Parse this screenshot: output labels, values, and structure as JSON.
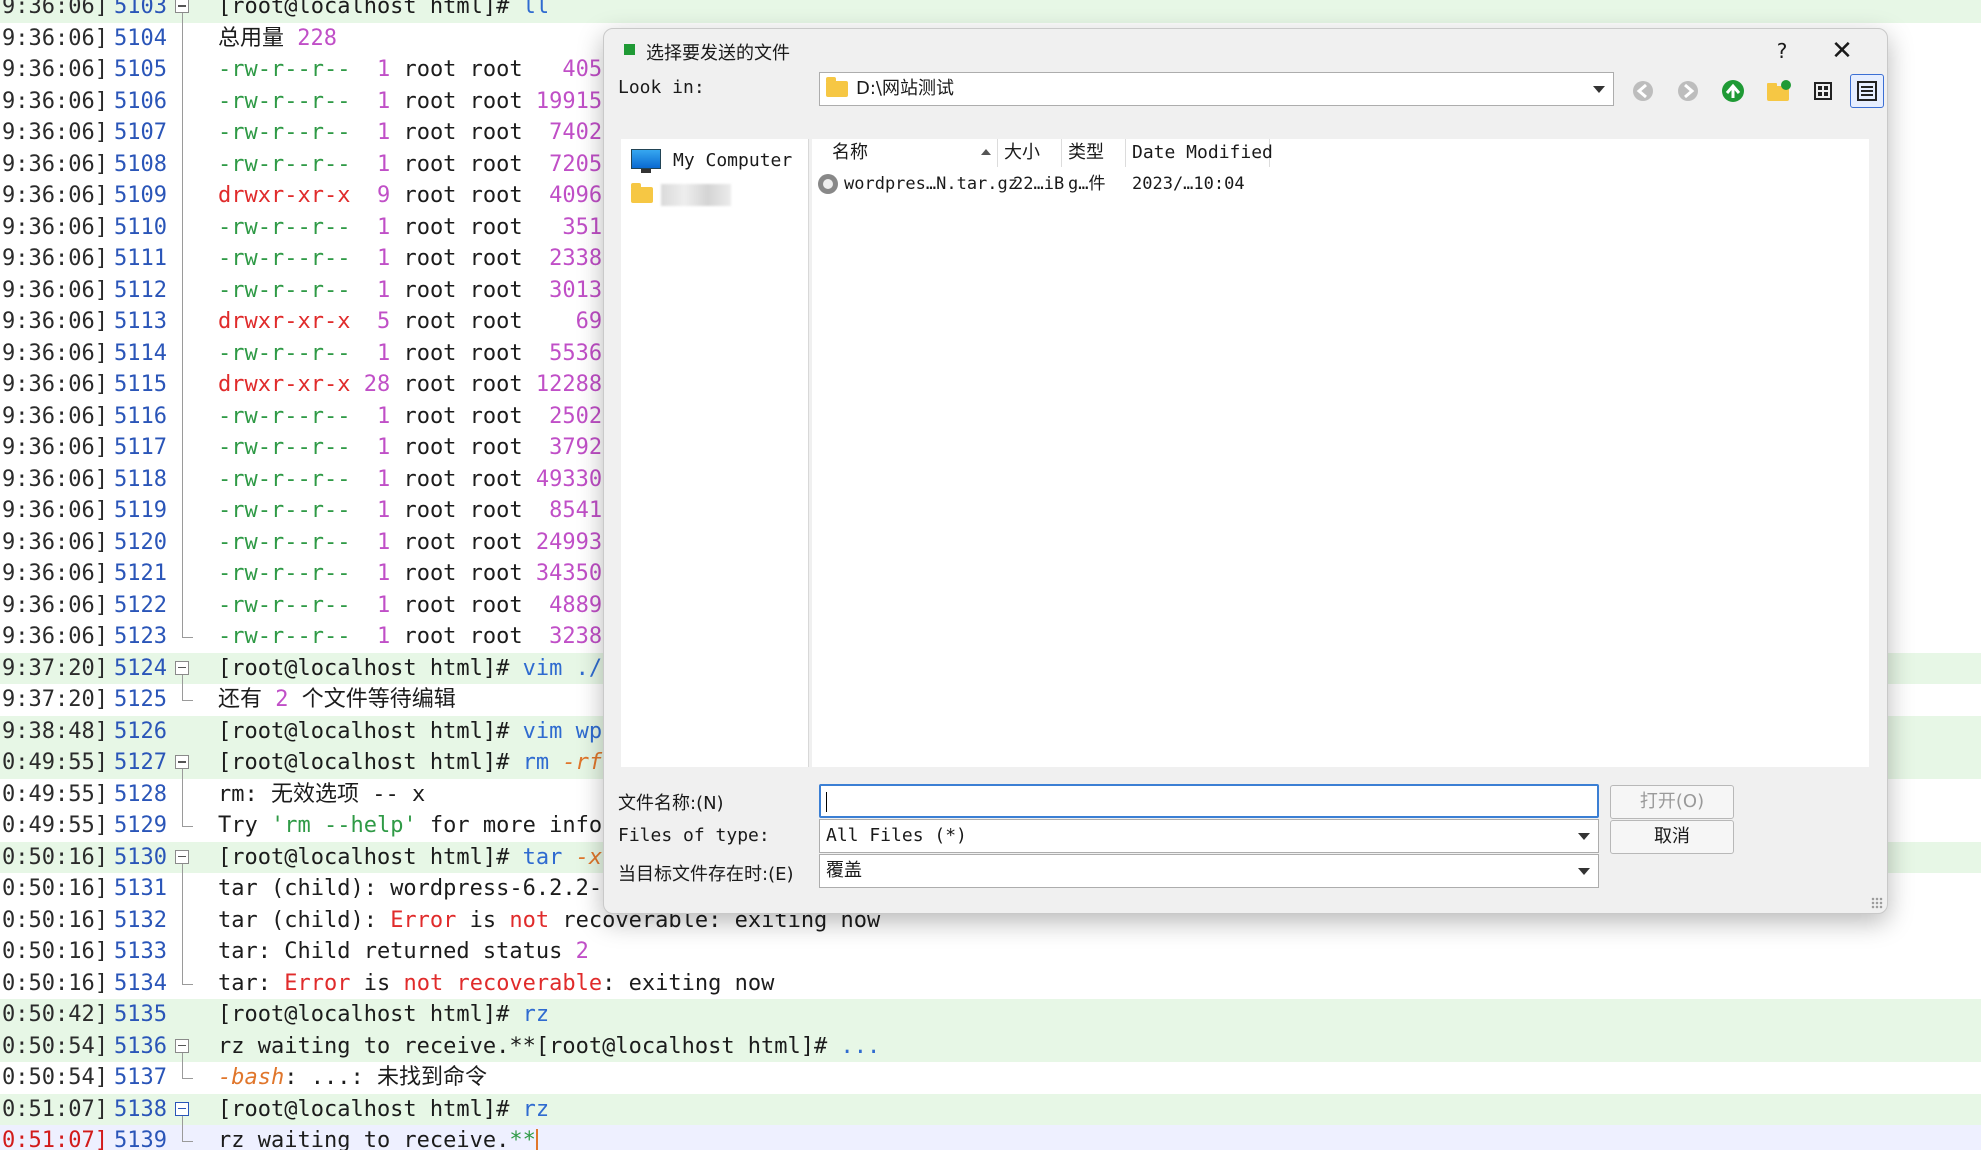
{
  "terminal": {
    "lines": [
      {
        "ts": "9:36:06]",
        "ln": "5103",
        "fold": "box",
        "hl": true,
        "segs": [
          [
            "[root@localhost html]# ",
            "dark"
          ],
          [
            "ll",
            "blue"
          ]
        ]
      },
      {
        "ts": "9:36:06]",
        "ln": "5104",
        "fold": "line",
        "segs": [
          [
            "总用量 ",
            "dark"
          ],
          [
            "228",
            "mag"
          ]
        ]
      },
      {
        "ts": "9:36:06]",
        "ln": "5105",
        "fold": "line",
        "segs": [
          [
            "-rw-r--r--",
            "green"
          ],
          [
            "  ",
            "dark"
          ],
          [
            "1",
            "mag"
          ],
          [
            " root root ",
            "dark"
          ],
          [
            "  405",
            "mag"
          ]
        ]
      },
      {
        "ts": "9:36:06]",
        "ln": "5106",
        "fold": "line",
        "segs": [
          [
            "-rw-r--r--",
            "green"
          ],
          [
            "  ",
            "dark"
          ],
          [
            "1",
            "mag"
          ],
          [
            " root root ",
            "dark"
          ],
          [
            "19915",
            "mag"
          ]
        ]
      },
      {
        "ts": "9:36:06]",
        "ln": "5107",
        "fold": "line",
        "segs": [
          [
            "-rw-r--r--",
            "green"
          ],
          [
            "  ",
            "dark"
          ],
          [
            "1",
            "mag"
          ],
          [
            " root root ",
            "dark"
          ],
          [
            " 7402",
            "mag"
          ]
        ]
      },
      {
        "ts": "9:36:06]",
        "ln": "5108",
        "fold": "line",
        "segs": [
          [
            "-rw-r--r--",
            "green"
          ],
          [
            "  ",
            "dark"
          ],
          [
            "1",
            "mag"
          ],
          [
            " root root ",
            "dark"
          ],
          [
            " 7205",
            "mag"
          ]
        ]
      },
      {
        "ts": "9:36:06]",
        "ln": "5109",
        "fold": "line",
        "segs": [
          [
            "drwxr-xr-x",
            "red"
          ],
          [
            "  ",
            "dark"
          ],
          [
            "9",
            "mag"
          ],
          [
            " root root ",
            "dark"
          ],
          [
            " 4096",
            "mag"
          ]
        ]
      },
      {
        "ts": "9:36:06]",
        "ln": "5110",
        "fold": "line",
        "segs": [
          [
            "-rw-r--r--",
            "green"
          ],
          [
            "  ",
            "dark"
          ],
          [
            "1",
            "mag"
          ],
          [
            " root root ",
            "dark"
          ],
          [
            "  351",
            "mag"
          ]
        ]
      },
      {
        "ts": "9:36:06]",
        "ln": "5111",
        "fold": "line",
        "segs": [
          [
            "-rw-r--r--",
            "green"
          ],
          [
            "  ",
            "dark"
          ],
          [
            "1",
            "mag"
          ],
          [
            " root root ",
            "dark"
          ],
          [
            " 2338",
            "mag"
          ]
        ]
      },
      {
        "ts": "9:36:06]",
        "ln": "5112",
        "fold": "line",
        "segs": [
          [
            "-rw-r--r--",
            "green"
          ],
          [
            "  ",
            "dark"
          ],
          [
            "1",
            "mag"
          ],
          [
            " root root ",
            "dark"
          ],
          [
            " 3013",
            "mag"
          ]
        ]
      },
      {
        "ts": "9:36:06]",
        "ln": "5113",
        "fold": "line",
        "segs": [
          [
            "drwxr-xr-x",
            "red"
          ],
          [
            "  ",
            "dark"
          ],
          [
            "5",
            "mag"
          ],
          [
            " root root ",
            "dark"
          ],
          [
            "   69",
            "mag"
          ]
        ]
      },
      {
        "ts": "9:36:06]",
        "ln": "5114",
        "fold": "line",
        "segs": [
          [
            "-rw-r--r--",
            "green"
          ],
          [
            "  ",
            "dark"
          ],
          [
            "1",
            "mag"
          ],
          [
            " root root ",
            "dark"
          ],
          [
            " 5536",
            "mag"
          ]
        ]
      },
      {
        "ts": "9:36:06]",
        "ln": "5115",
        "fold": "line",
        "segs": [
          [
            "drwxr-xr-x",
            "red"
          ],
          [
            " ",
            "dark"
          ],
          [
            "28",
            "mag"
          ],
          [
            " root root ",
            "dark"
          ],
          [
            "12288",
            "mag"
          ]
        ]
      },
      {
        "ts": "9:36:06]",
        "ln": "5116",
        "fold": "line",
        "segs": [
          [
            "-rw-r--r--",
            "green"
          ],
          [
            "  ",
            "dark"
          ],
          [
            "1",
            "mag"
          ],
          [
            " root root ",
            "dark"
          ],
          [
            " 2502",
            "mag"
          ]
        ]
      },
      {
        "ts": "9:36:06]",
        "ln": "5117",
        "fold": "line",
        "segs": [
          [
            "-rw-r--r--",
            "green"
          ],
          [
            "  ",
            "dark"
          ],
          [
            "1",
            "mag"
          ],
          [
            " root root ",
            "dark"
          ],
          [
            " 3792",
            "mag"
          ]
        ]
      },
      {
        "ts": "9:36:06]",
        "ln": "5118",
        "fold": "line",
        "segs": [
          [
            "-rw-r--r--",
            "green"
          ],
          [
            "  ",
            "dark"
          ],
          [
            "1",
            "mag"
          ],
          [
            " root root ",
            "dark"
          ],
          [
            "49330",
            "mag"
          ]
        ]
      },
      {
        "ts": "9:36:06]",
        "ln": "5119",
        "fold": "line",
        "segs": [
          [
            "-rw-r--r--",
            "green"
          ],
          [
            "  ",
            "dark"
          ],
          [
            "1",
            "mag"
          ],
          [
            " root root ",
            "dark"
          ],
          [
            " 8541",
            "mag"
          ]
        ]
      },
      {
        "ts": "9:36:06]",
        "ln": "5120",
        "fold": "line",
        "segs": [
          [
            "-rw-r--r--",
            "green"
          ],
          [
            "  ",
            "dark"
          ],
          [
            "1",
            "mag"
          ],
          [
            " root root ",
            "dark"
          ],
          [
            "24993",
            "mag"
          ]
        ]
      },
      {
        "ts": "9:36:06]",
        "ln": "5121",
        "fold": "line",
        "segs": [
          [
            "-rw-r--r--",
            "green"
          ],
          [
            "  ",
            "dark"
          ],
          [
            "1",
            "mag"
          ],
          [
            " root root ",
            "dark"
          ],
          [
            "34350",
            "mag"
          ]
        ]
      },
      {
        "ts": "9:36:06]",
        "ln": "5122",
        "fold": "line",
        "segs": [
          [
            "-rw-r--r--",
            "green"
          ],
          [
            "  ",
            "dark"
          ],
          [
            "1",
            "mag"
          ],
          [
            " root root ",
            "dark"
          ],
          [
            " 4889",
            "mag"
          ]
        ]
      },
      {
        "ts": "9:36:06]",
        "ln": "5123",
        "fold": "end",
        "segs": [
          [
            "-rw-r--r--",
            "green"
          ],
          [
            "  ",
            "dark"
          ],
          [
            "1",
            "mag"
          ],
          [
            " root root ",
            "dark"
          ],
          [
            " 3238",
            "mag"
          ]
        ]
      },
      {
        "ts": "9:37:20]",
        "ln": "5124",
        "fold": "box",
        "hl": true,
        "segs": [
          [
            "[root@localhost html]# ",
            "dark"
          ],
          [
            "vim ./",
            "blue"
          ]
        ]
      },
      {
        "ts": "9:37:20]",
        "ln": "5125",
        "fold": "end",
        "segs": [
          [
            "还有 ",
            "dark"
          ],
          [
            "2",
            "mag"
          ],
          [
            " 个文件等待编辑",
            "dark"
          ]
        ]
      },
      {
        "ts": "9:38:48]",
        "ln": "5126",
        "fold": "none",
        "hl": true,
        "segs": [
          [
            "[root@localhost html]# ",
            "dark"
          ],
          [
            "vim wp",
            "blue"
          ]
        ]
      },
      {
        "ts": "0:49:55]",
        "ln": "5127",
        "fold": "box",
        "hl": true,
        "segs": [
          [
            "[root@localhost html]# ",
            "dark"
          ],
          [
            "rm ",
            "blue"
          ],
          [
            "-rf",
            "orange"
          ]
        ]
      },
      {
        "ts": "0:49:55]",
        "ln": "5128",
        "fold": "line",
        "segs": [
          [
            "rm: 无效选项 -- x",
            "dark"
          ]
        ]
      },
      {
        "ts": "0:49:55]",
        "ln": "5129",
        "fold": "end",
        "segs": [
          [
            "Try ",
            "dark"
          ],
          [
            "'rm --help'",
            "green"
          ],
          [
            " for more info",
            "dark"
          ]
        ]
      },
      {
        "ts": "0:50:16]",
        "ln": "5130",
        "fold": "box",
        "hl": true,
        "segs": [
          [
            "[root@localhost html]# ",
            "dark"
          ],
          [
            "tar ",
            "blue"
          ],
          [
            "-x",
            "orange"
          ]
        ]
      },
      {
        "ts": "0:50:16]",
        "ln": "5131",
        "fold": "line",
        "segs": [
          [
            "tar (child): wordpress-6.2.2-",
            "dark"
          ]
        ]
      },
      {
        "ts": "0:50:16]",
        "ln": "5132",
        "fold": "line",
        "segs": [
          [
            "tar (child): ",
            "dark"
          ],
          [
            "Error",
            "red"
          ],
          [
            " is ",
            "dark"
          ],
          [
            "not",
            "red"
          ],
          [
            " recoverable: exiting now",
            "dark"
          ]
        ]
      },
      {
        "ts": "0:50:16]",
        "ln": "5133",
        "fold": "line",
        "segs": [
          [
            "tar: Child returned status ",
            "dark"
          ],
          [
            "2",
            "mag"
          ]
        ]
      },
      {
        "ts": "0:50:16]",
        "ln": "5134",
        "fold": "end",
        "segs": [
          [
            "tar: ",
            "dark"
          ],
          [
            "Error",
            "red"
          ],
          [
            " is ",
            "dark"
          ],
          [
            "not",
            "red"
          ],
          [
            " ",
            "dark"
          ],
          [
            "recoverable",
            "red"
          ],
          [
            ": exiting now",
            "dark"
          ]
        ]
      },
      {
        "ts": "0:50:42]",
        "ln": "5135",
        "fold": "none",
        "hl": true,
        "segs": [
          [
            "[root@localhost html]# ",
            "dark"
          ],
          [
            "rz",
            "blue"
          ]
        ]
      },
      {
        "ts": "0:50:54]",
        "ln": "5136",
        "fold": "box",
        "hl": true,
        "segs": [
          [
            "rz waiting to receive.**[root@localhost html]# ",
            "dark"
          ],
          [
            "...",
            "blue"
          ]
        ]
      },
      {
        "ts": "0:50:54]",
        "ln": "5137",
        "fold": "end",
        "segs": [
          [
            "-bash",
            "orange"
          ],
          [
            ": ...: 未找到命令",
            "dark"
          ]
        ]
      },
      {
        "ts": "0:51:07]",
        "ln": "5138",
        "fold": "boxact",
        "hl": true,
        "segs": [
          [
            "[root@localhost html]# ",
            "dark"
          ],
          [
            "rz",
            "blue"
          ]
        ]
      },
      {
        "ts": "0:51:07]",
        "ln": "5139",
        "fold": "end",
        "cur": true,
        "segs": [
          [
            "rz waiting to receive.",
            "dark"
          ],
          [
            "**",
            "green"
          ]
        ]
      }
    ]
  },
  "dialog": {
    "title": "选择要发送的文件",
    "help": "?",
    "close": "✕",
    "look_in_label": "Look in:",
    "look_in_value": "D:\\网站测试",
    "sidebar": {
      "my_computer": "My Computer"
    },
    "columns": {
      "name": "名称",
      "size": "大小",
      "type": "类型",
      "date": "Date Modified"
    },
    "files": [
      {
        "name": "wordpres…N.tar.gz",
        "size": "22…iB",
        "type": "g…件",
        "date": "2023/…10:04"
      }
    ],
    "filename_label": "文件名称:(N)",
    "filename_value": "",
    "filetype_label": "Files of type:",
    "filetype_value": "All Files (*)",
    "exists_label": "当目标文件存在时:(E)",
    "exists_value": "覆盖",
    "open_button": "打开(O)",
    "cancel_button": "取消",
    "icons": [
      "back-icon",
      "forward-icon",
      "up-icon",
      "new-folder-icon",
      "list-view-icon",
      "detail-view-icon"
    ],
    "colors": {
      "accent": "#3b7fd4",
      "app_icon": "#1f9a35"
    }
  }
}
